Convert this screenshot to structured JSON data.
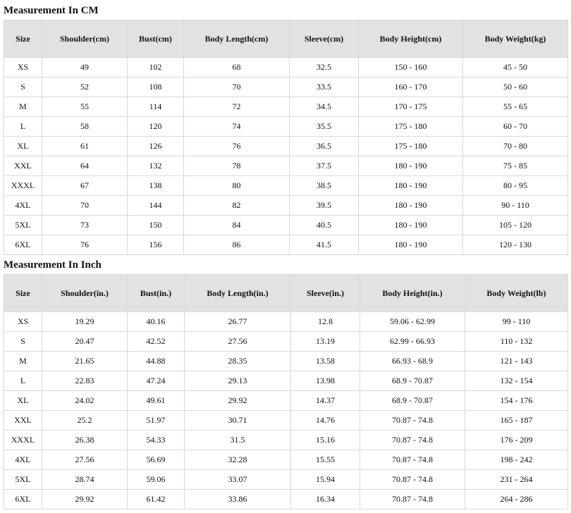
{
  "sections": [
    {
      "title": "Measurement In CM",
      "headers": [
        "Size",
        "Shoulder(cm)",
        "Bust(cm)",
        "Body Length(cm)",
        "Sleeve(cm)",
        "Body Height(cm)",
        "Body Weight(kg)"
      ],
      "rows": [
        [
          "XS",
          "49",
          "102",
          "68",
          "32.5",
          "150 - 160",
          "45 - 50"
        ],
        [
          "S",
          "52",
          "108",
          "70",
          "33.5",
          "160 - 170",
          "50 - 60"
        ],
        [
          "M",
          "55",
          "114",
          "72",
          "34.5",
          "170 - 175",
          "55 - 65"
        ],
        [
          "L",
          "58",
          "120",
          "74",
          "35.5",
          "175 - 180",
          "60 - 70"
        ],
        [
          "XL",
          "61",
          "126",
          "76",
          "36.5",
          "175 - 180",
          "70 - 80"
        ],
        [
          "XXL",
          "64",
          "132",
          "78",
          "37.5",
          "180 - 190",
          "75 - 85"
        ],
        [
          "XXXL",
          "67",
          "138",
          "80",
          "38.5",
          "180 - 190",
          "80 - 95"
        ],
        [
          "4XL",
          "70",
          "144",
          "82",
          "39.5",
          "180 - 190",
          "90 - 110"
        ],
        [
          "5XL",
          "73",
          "150",
          "84",
          "40.5",
          "180 - 190",
          "105 - 120"
        ],
        [
          "6XL",
          "76",
          "156",
          "86",
          "41.5",
          "180 - 190",
          "120 - 130"
        ]
      ]
    },
    {
      "title": "Measurement In Inch",
      "headers": [
        "Size",
        "Shoulder(in.)",
        "Bust(in.)",
        "Body Length(in.)",
        "Sleeve(in.)",
        "Body Height(in.)",
        "Body Weight(lb)"
      ],
      "rows": [
        [
          "XS",
          "19.29",
          "40.16",
          "26.77",
          "12.8",
          "59.06 - 62.99",
          "99 - 110"
        ],
        [
          "S",
          "20.47",
          "42.52",
          "27.56",
          "13.19",
          "62.99 - 66.93",
          "110 - 132"
        ],
        [
          "M",
          "21.65",
          "44.88",
          "28.35",
          "13.58",
          "66.93 - 68.9",
          "121 - 143"
        ],
        [
          "L",
          "22.83",
          "47.24",
          "29.13",
          "13.98",
          "68.9 - 70.87",
          "132 - 154"
        ],
        [
          "XL",
          "24.02",
          "49.61",
          "29.92",
          "14.37",
          "68.9 - 70.87",
          "154 - 176"
        ],
        [
          "XXL",
          "25.2",
          "51.97",
          "30.71",
          "14.76",
          "70.87 - 74.8",
          "165 - 187"
        ],
        [
          "XXXL",
          "26.38",
          "54.33",
          "31.5",
          "15.16",
          "70.87 - 74.8",
          "176 - 209"
        ],
        [
          "4XL",
          "27.56",
          "56.69",
          "32.28",
          "15.55",
          "70.87 - 74.8",
          "198 - 242"
        ],
        [
          "5XL",
          "28.74",
          "59.06",
          "33.07",
          "15.94",
          "70.87 - 74.8",
          "231 - 264"
        ],
        [
          "6XL",
          "29.92",
          "61.42",
          "33.86",
          "16.34",
          "70.87 - 74.8",
          "264 - 286"
        ]
      ]
    }
  ]
}
